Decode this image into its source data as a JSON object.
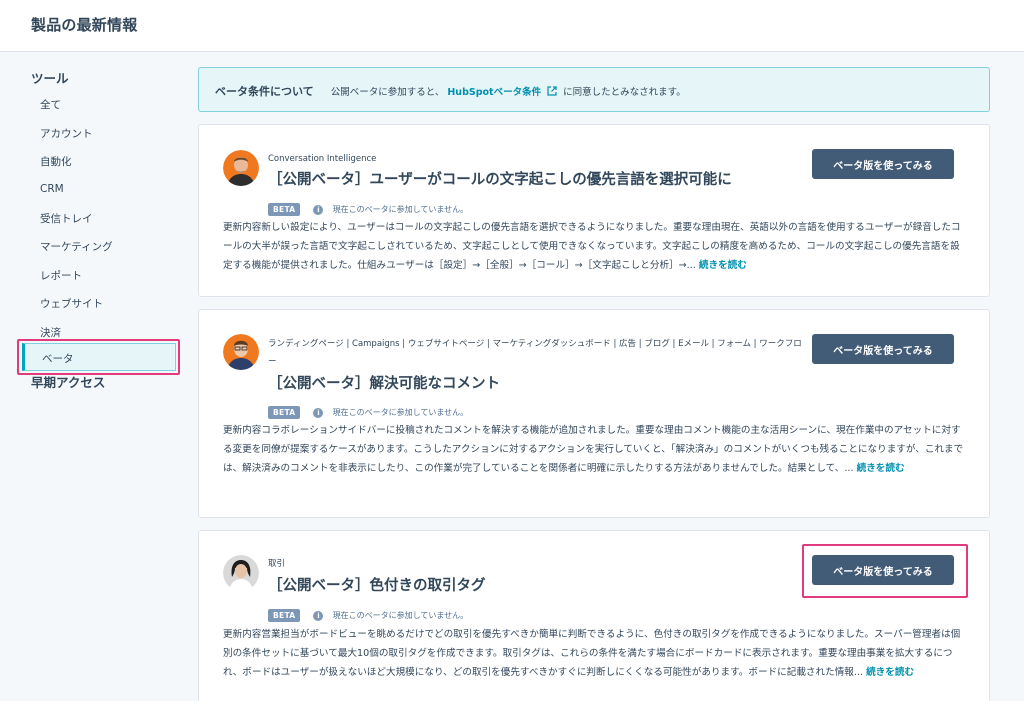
{
  "header": {
    "title": "製品の最新情報"
  },
  "sidebar": {
    "tools_heading": "ツール",
    "items": [
      {
        "label": "全て"
      },
      {
        "label": "アカウント"
      },
      {
        "label": "自動化"
      },
      {
        "label": "CRM"
      },
      {
        "label": "受信トレイ"
      },
      {
        "label": "マーケティング"
      },
      {
        "label": "レポート"
      },
      {
        "label": "ウェブサイト"
      },
      {
        "label": "決済"
      }
    ],
    "early_access_heading": "早期アクセス",
    "active_item": "ベータ"
  },
  "notice": {
    "title": "ベータ条件について",
    "text_before": "公開ベータに参加すると、",
    "link": "HubSpotベータ条件",
    "text_after": "に同意したとみなされます。"
  },
  "cards": [
    {
      "category": "Conversation Intelligence",
      "title": "［公開ベータ］ユーザーがコールの文字起こしの優先言語を選択可能に",
      "badge": "BETA",
      "status": "現在このベータに参加していません。",
      "description": "更新内容新しい設定により、ユーザーはコールの文字起こしの優先言語を選択できるようになりました。重要な理由現在、英語以外の言語を使用するユーザーが録音したコールの大半が誤った言語で文字起こしされているため、文字起こしとして使用できなくなっています。文字起こしの精度を高めるため、コールの文字起こしの優先言語を設定する機能が提供されました。仕組みユーザーは［設定］→［全般］→［コール］→［文字起こしと分析］→...",
      "read_more": "続きを読む",
      "button": "ベータ版を使ってみる"
    },
    {
      "category": "ランディングページ | Campaigns | ウェブサイトページ | マーケティングダッシュボード | 広告 | ブログ | Eメール | フォーム | ワークフロー",
      "title": "［公開ベータ］解決可能なコメント",
      "badge": "BETA",
      "status": "現在このベータに参加していません。",
      "description": "更新内容コラボレーションサイドバーに投稿されたコメントを解決する機能が追加されました。重要な理由コメント機能の主な活用シーンに、現在作業中のアセットに対する変更を同僚が提案するケースがあります。こうしたアクションに対するアクションを実行していくと、「解決済み」のコメントがいくつも残ることになりますが、これまでは、解決済みのコメントを非表示にしたり、この作業が完了していることを関係者に明確に示したりする方法がありませんでした。結果として、...",
      "read_more": "続きを読む",
      "button": "ベータ版を使ってみる"
    },
    {
      "category": "取引",
      "title": "［公開ベータ］色付きの取引タグ",
      "badge": "BETA",
      "status": "現在このベータに参加していません。",
      "description": "更新内容営業担当がボードビューを眺めるだけでどの取引を優先すべきか簡単に判断できるように、色付きの取引タグを作成できるようになりました。スーパー管理者は個別の条件セットに基づいて最大10個の取引タグを作成できます。取引タグは、これらの条件を満たす場合にボードカードに表示されます。重要な理由事業を拡大するにつれ、ボードはユーザーが扱えないほど大規模になり、どの取引を優先すべきかすぐに判断しにくくなる可能性があります。ボードに記載された情報...",
      "read_more": "続きを読む",
      "button": "ベータ版を使ってみる"
    }
  ],
  "colors": {
    "accent": "#00a4bd",
    "link": "#0091ae",
    "button": "#425b76",
    "highlight": "#e23b7d",
    "badge": "#7c98b6"
  }
}
